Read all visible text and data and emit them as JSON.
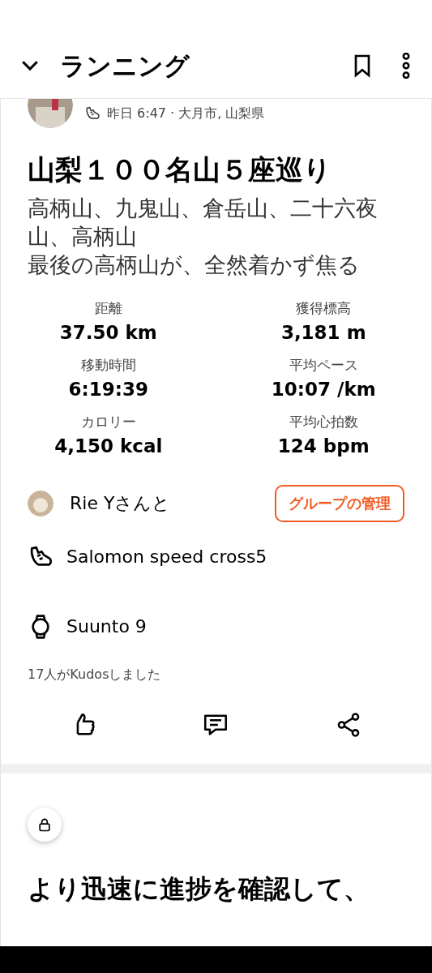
{
  "header": {
    "title": "ランニング"
  },
  "activity": {
    "meta": "昨日 6:47 · 大月市, 山梨県",
    "title": "山梨１００名山５座巡り",
    "description": [
      "高柄山、九鬼山、倉岳山、二十六夜山、高柄山",
      "最後の高柄山が、全然着かず焦る"
    ]
  },
  "stats": [
    {
      "label": "距離",
      "value": "37.50 km"
    },
    {
      "label": "獲得標高",
      "value": "3,181 m"
    },
    {
      "label": "移動時間",
      "value": "6:19:39"
    },
    {
      "label": "平均ペース",
      "value": "10:07 /km"
    },
    {
      "label": "カロリー",
      "value": "4,150 kcal"
    },
    {
      "label": "平均心拍数",
      "value": "124 bpm"
    }
  ],
  "group": {
    "text": "Rie Yさんと",
    "button": "グループの管理"
  },
  "gear": [
    {
      "kind": "shoe",
      "name": "Salomon speed cross5"
    },
    {
      "kind": "watch",
      "name": "Suunto 9"
    }
  ],
  "kudos": "17人がKudosしました",
  "promo": {
    "title": "より迅速に進捗を確認して、"
  }
}
